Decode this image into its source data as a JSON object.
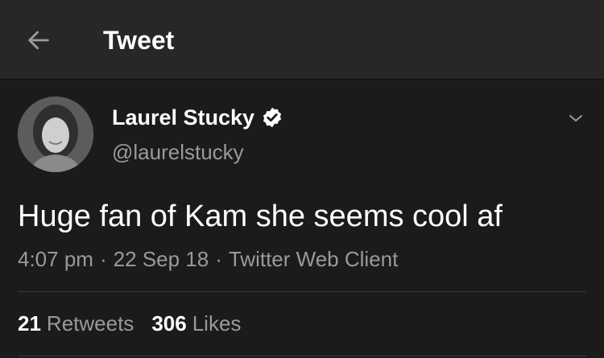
{
  "header": {
    "title": "Tweet",
    "back_icon": "arrow-left-icon"
  },
  "tweet": {
    "author": {
      "display_name": "Laurel Stucky",
      "handle": "@laurelstucky",
      "verified": true
    },
    "text": "Huge fan of Kam she seems cool af",
    "time": "4:07 pm",
    "separator": "·",
    "date": "22 Sep 18",
    "client": "Twitter Web Client",
    "stats": {
      "retweets_count": "21",
      "retweets_label": "Retweets",
      "likes_count": "306",
      "likes_label": "Likes"
    }
  },
  "colors": {
    "background": "#1b1b1b",
    "header_background": "#272727",
    "primary_text": "#ffffff",
    "secondary_text": "#9a9a9a",
    "divider": "#3a3a3a"
  }
}
